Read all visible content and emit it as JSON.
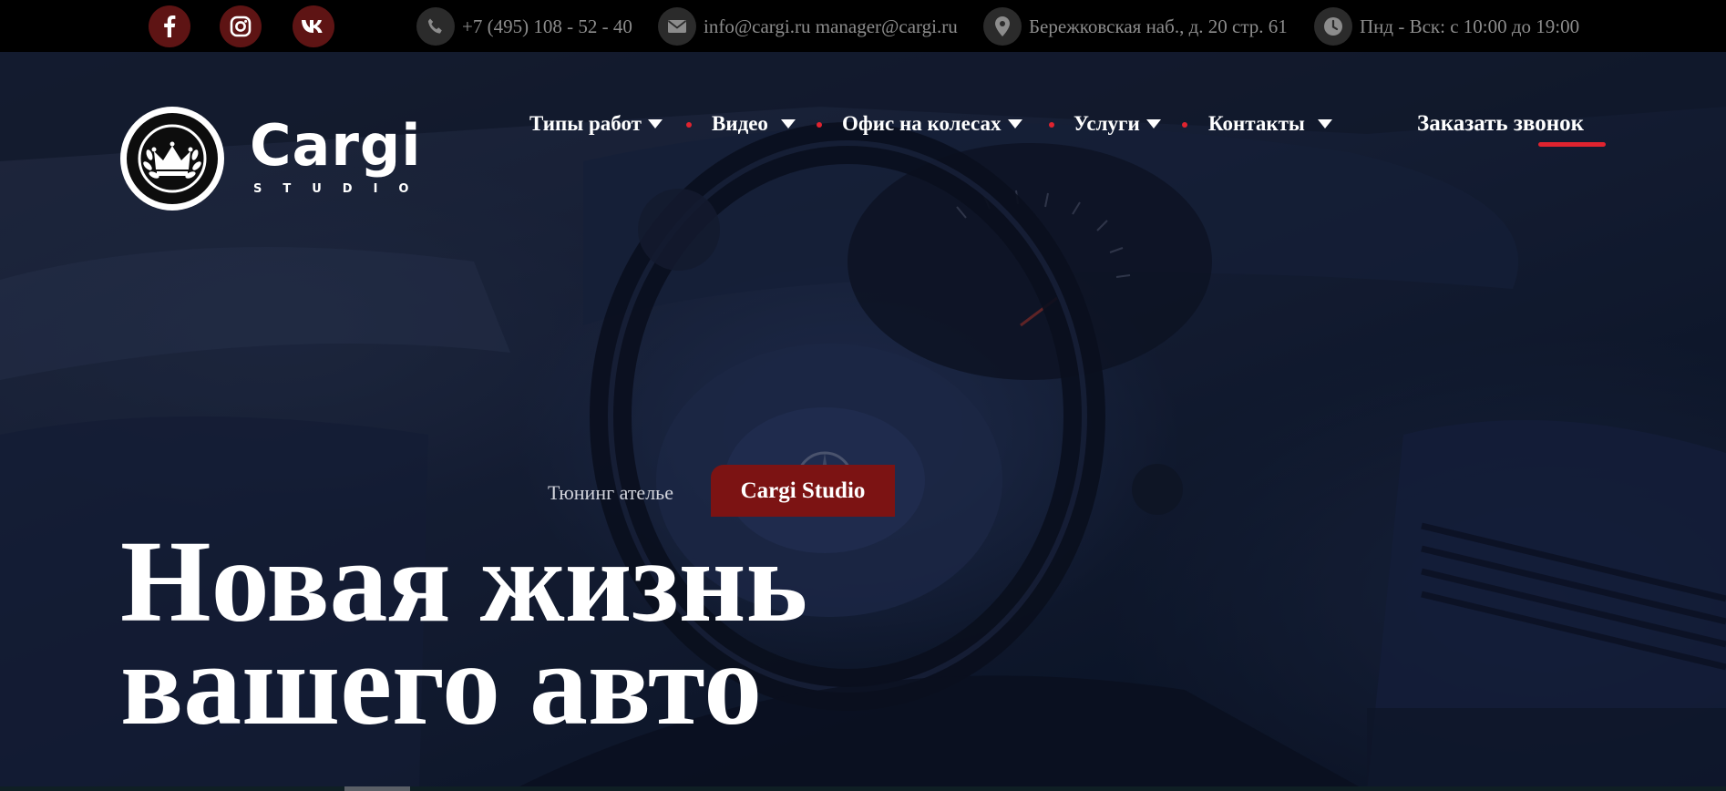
{
  "topbar": {
    "social": [
      {
        "name": "facebook",
        "icon": "facebook-icon"
      },
      {
        "name": "instagram",
        "icon": "instagram-icon"
      },
      {
        "name": "vk",
        "icon": "vk-icon"
      }
    ],
    "phone": {
      "icon": "phone-icon",
      "text": "+7 (495) 108 - 52 - 40"
    },
    "email": {
      "icon": "envelope-icon",
      "text": "info@cargi.ru manager@cargi.ru"
    },
    "address": {
      "icon": "map-pin-icon",
      "text": "Бережковская наб., д. 20 стр. 61"
    },
    "hours": {
      "icon": "clock-icon",
      "text": "Пнд - Вск: с 10:00 до 19:00"
    }
  },
  "logo": {
    "icon": "crown-laurel-icon",
    "wordmark": "Cargi",
    "sub": "STUDIO"
  },
  "nav": {
    "items": [
      {
        "label": "Типы работ"
      },
      {
        "label": "Видео"
      },
      {
        "label": "Офис на колесах"
      },
      {
        "label": "Услуги"
      },
      {
        "label": "Контакты"
      }
    ],
    "cta": "Заказать звонок"
  },
  "hero": {
    "tagline": "Тюнинг ателье",
    "badge": "Cargi Studio",
    "headline_line1": "Новая жизнь",
    "headline_line2": "вашего авто"
  },
  "colors": {
    "accent_red": "#e0232f",
    "badge_bg": "#7c1313",
    "social_bg": "#5e1414",
    "topbar_bg": "#000000"
  }
}
